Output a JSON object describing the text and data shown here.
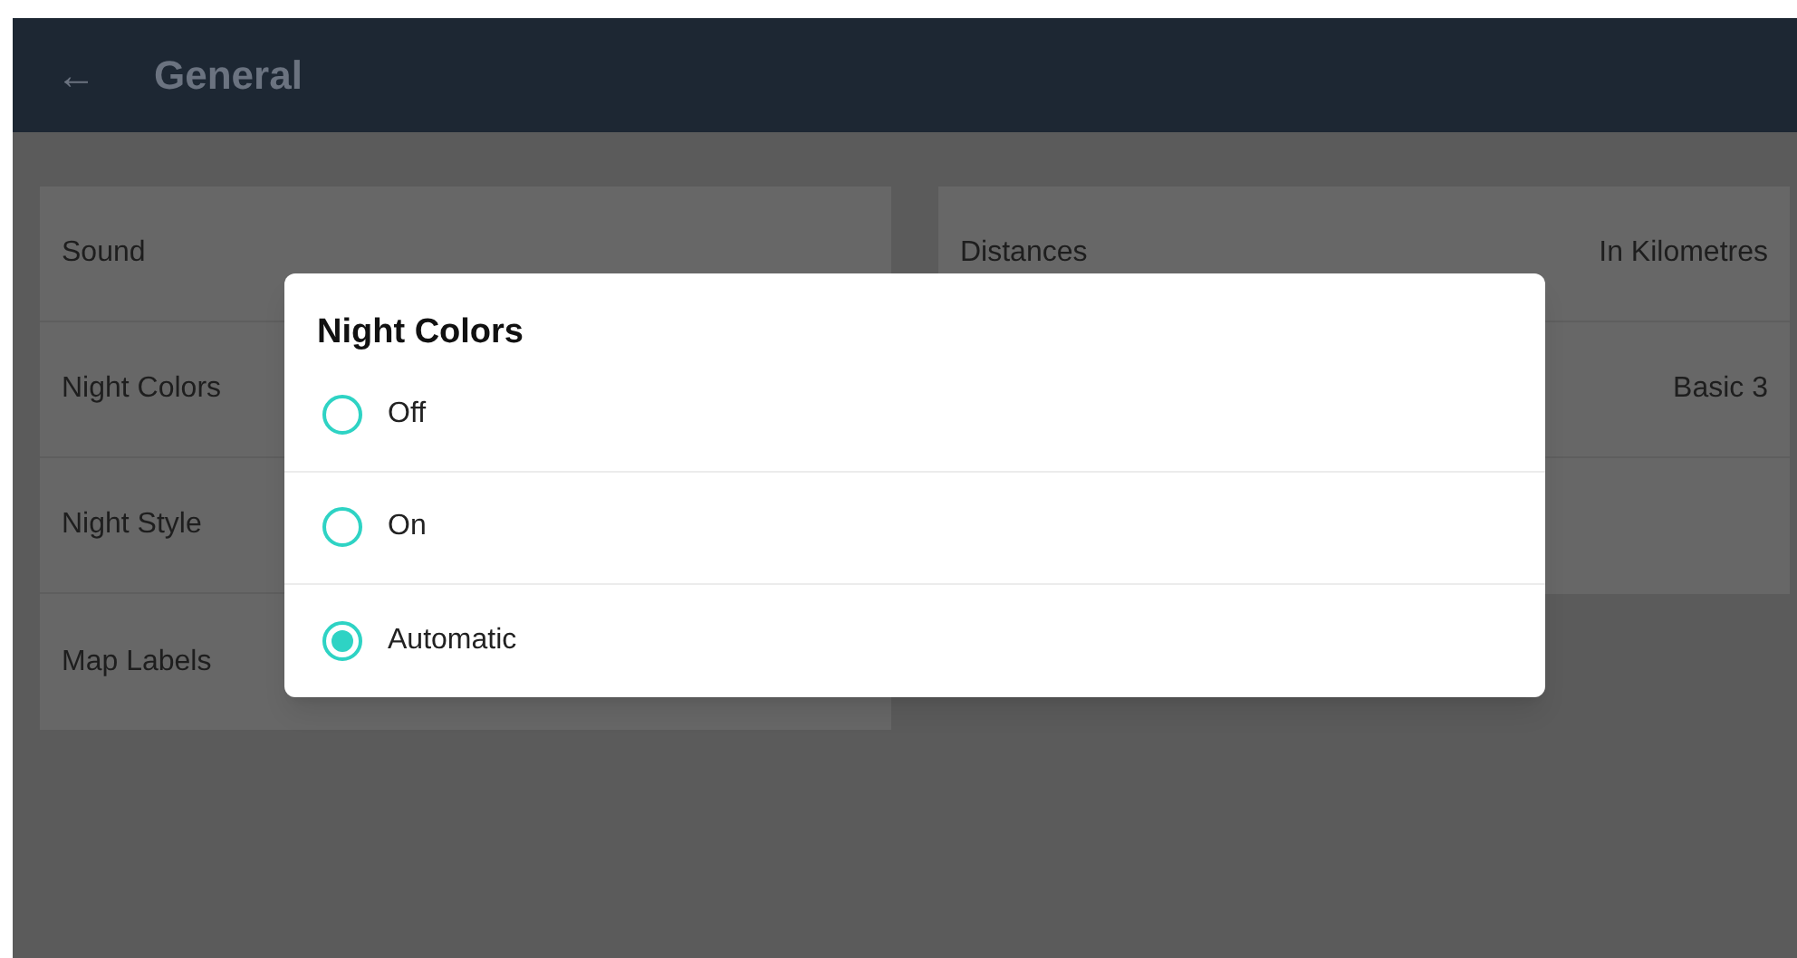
{
  "header": {
    "back_icon": "←",
    "title": "General"
  },
  "left_settings": [
    {
      "label": "Sound"
    },
    {
      "label": "Night Colors"
    },
    {
      "label": "Night Style"
    },
    {
      "label": "Map Labels"
    }
  ],
  "right_settings": [
    {
      "label": "Distances",
      "value": "In Kilometres"
    },
    {
      "value": "Basic 3"
    }
  ],
  "dialog": {
    "title": "Night Colors",
    "options": [
      {
        "label": "Off",
        "selected": false
      },
      {
        "label": "On",
        "selected": false
      },
      {
        "label": "Automatic",
        "selected": true
      }
    ]
  }
}
